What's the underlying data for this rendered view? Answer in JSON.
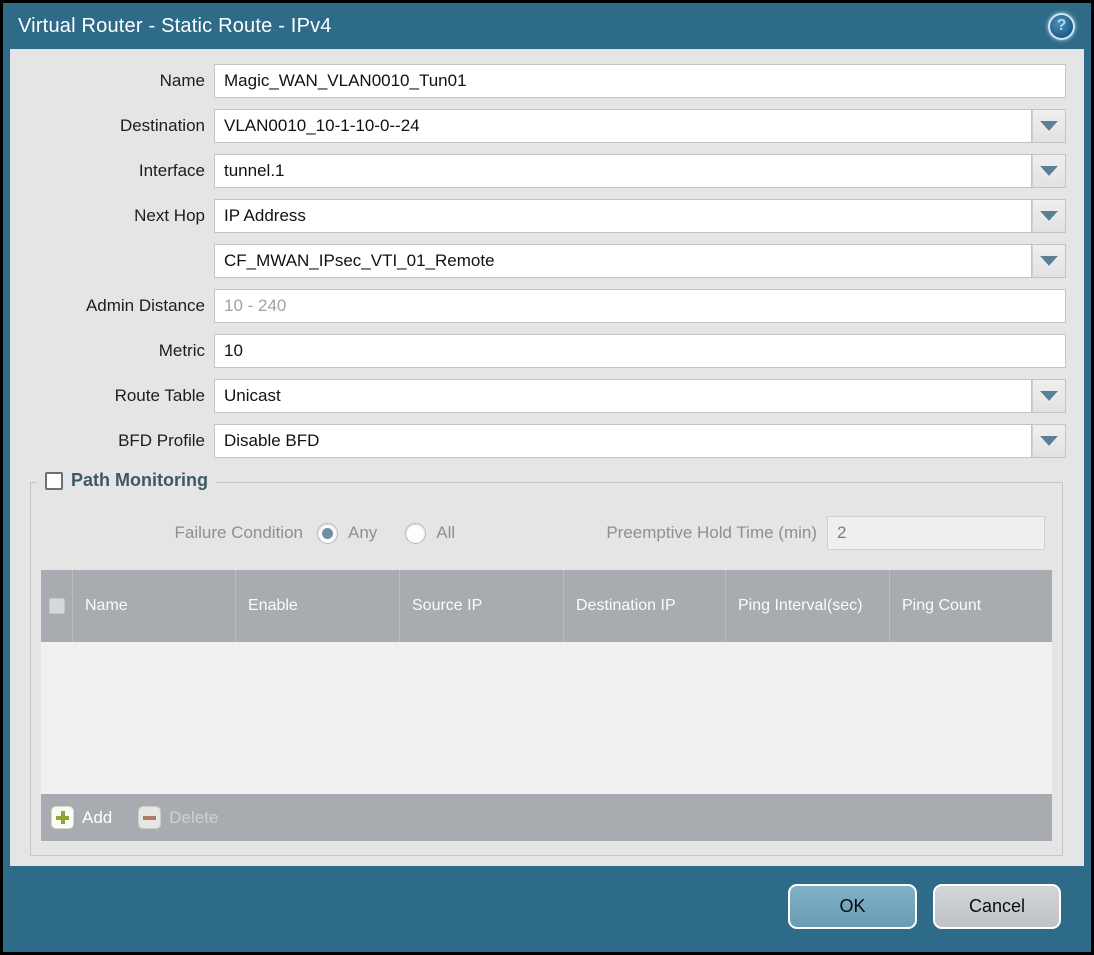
{
  "dialog": {
    "title": "Virtual Router - Static Route - IPv4",
    "help_icon": "?"
  },
  "form": {
    "name": {
      "label": "Name",
      "value": "Magic_WAN_VLAN0010_Tun01"
    },
    "destination": {
      "label": "Destination",
      "value": "VLAN0010_10-1-10-0--24"
    },
    "interface": {
      "label": "Interface",
      "value": "tunnel.1"
    },
    "next_hop": {
      "label": "Next Hop",
      "value": "IP Address"
    },
    "next_hop_address": {
      "label": "",
      "value": "CF_MWAN_IPsec_VTI_01_Remote"
    },
    "admin_distance": {
      "label": "Admin Distance",
      "placeholder": "10 - 240"
    },
    "metric": {
      "label": "Metric",
      "value": "10"
    },
    "route_table": {
      "label": "Route Table",
      "value": "Unicast"
    },
    "bfd_profile": {
      "label": "BFD Profile",
      "value": "Disable BFD"
    }
  },
  "path_monitoring": {
    "legend": "Path Monitoring",
    "checkbox_checked": false,
    "failure_condition": {
      "label": "Failure Condition",
      "options": [
        {
          "label": "Any",
          "selected": true
        },
        {
          "label": "All",
          "selected": false
        }
      ]
    },
    "preemptive_hold_time": {
      "label": "Preemptive Hold Time (min)",
      "value": "2"
    },
    "table": {
      "columns": [
        "Name",
        "Enable",
        "Source IP",
        "Destination IP",
        "Ping Interval(sec)",
        "Ping Count"
      ],
      "rows": [],
      "add_label": "Add",
      "delete_label": "Delete"
    }
  },
  "footer": {
    "ok_label": "OK",
    "cancel_label": "Cancel"
  },
  "colors": {
    "title_bar": "#2e6b88",
    "content_bg": "#e5e5e5",
    "table_header": "#a8acb0",
    "ok_button": "#6fa3bb",
    "cancel_button": "#c7cacd",
    "add_icon_green": "#8ea33c",
    "delete_icon_red": "#b07a6a",
    "radio_selected": "#6b8fa3",
    "dropdown_arrow": "#5d7f94"
  }
}
